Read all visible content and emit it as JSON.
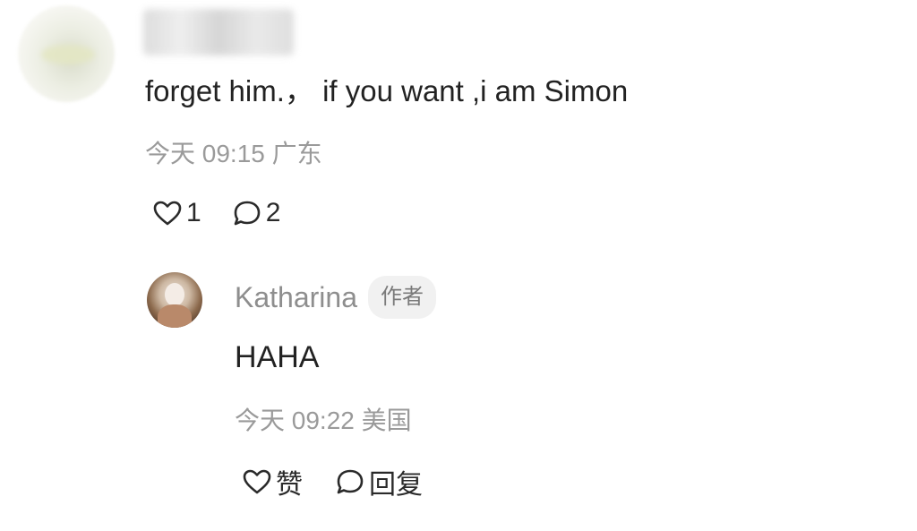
{
  "comment": {
    "text": "forget him.，  if you want ,i am Simon",
    "time": "今天 09:15",
    "location": "广东",
    "likes": "1",
    "replies": "2"
  },
  "reply": {
    "author": "Katharina",
    "badge": "作者",
    "text": "HAHA",
    "time": "今天 09:22",
    "location": "美国",
    "like_label": "赞",
    "reply_label": "回复"
  },
  "icons": {
    "like": "heart-outline-icon",
    "comment": "speech-bubble-outline-icon"
  }
}
